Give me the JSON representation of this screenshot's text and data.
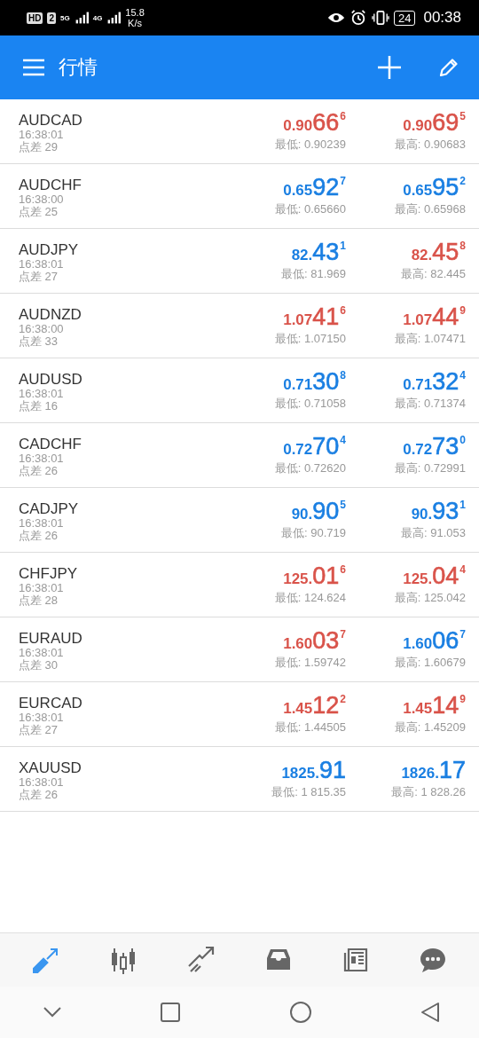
{
  "status_bar": {
    "hd": "HD",
    "sim": "2",
    "net1": "5G",
    "net2": "4G",
    "speed": "15.8",
    "speed_unit": "K/s",
    "battery": "24",
    "time": "00:38"
  },
  "header": {
    "title": "行情"
  },
  "quotes": [
    {
      "symbol": "AUDCAD",
      "time": "16:38:01",
      "spread": "点差 29",
      "bid": {
        "small": "0.90",
        "big": "66",
        "sup": "6",
        "color": "#d9534a"
      },
      "ask": {
        "small": "0.90",
        "big": "69",
        "sup": "5",
        "color": "#d9534a"
      },
      "low": "最低: 0.90239",
      "high": "最高: 0.90683"
    },
    {
      "symbol": "AUDCHF",
      "time": "16:38:00",
      "spread": "点差 25",
      "bid": {
        "small": "0.65",
        "big": "92",
        "sup": "7",
        "color": "#1a7fe2"
      },
      "ask": {
        "small": "0.65",
        "big": "95",
        "sup": "2",
        "color": "#1a7fe2"
      },
      "low": "最低: 0.65660",
      "high": "最高: 0.65968"
    },
    {
      "symbol": "AUDJPY",
      "time": "16:38:01",
      "spread": "点差 27",
      "bid": {
        "small": "82.",
        "big": "43",
        "sup": "1",
        "color": "#1a7fe2"
      },
      "ask": {
        "small": "82.",
        "big": "45",
        "sup": "8",
        "color": "#d9534a"
      },
      "low": "最低: 81.969",
      "high": "最高: 82.445"
    },
    {
      "symbol": "AUDNZD",
      "time": "16:38:00",
      "spread": "点差 33",
      "bid": {
        "small": "1.07",
        "big": "41",
        "sup": "6",
        "color": "#d9534a"
      },
      "ask": {
        "small": "1.07",
        "big": "44",
        "sup": "9",
        "color": "#d9534a"
      },
      "low": "最低: 1.07150",
      "high": "最高: 1.07471"
    },
    {
      "symbol": "AUDUSD",
      "time": "16:38:01",
      "spread": "点差 16",
      "bid": {
        "small": "0.71",
        "big": "30",
        "sup": "8",
        "color": "#1a7fe2"
      },
      "ask": {
        "small": "0.71",
        "big": "32",
        "sup": "4",
        "color": "#1a7fe2"
      },
      "low": "最低: 0.71058",
      "high": "最高: 0.71374"
    },
    {
      "symbol": "CADCHF",
      "time": "16:38:01",
      "spread": "点差 26",
      "bid": {
        "small": "0.72",
        "big": "70",
        "sup": "4",
        "color": "#1a7fe2"
      },
      "ask": {
        "small": "0.72",
        "big": "73",
        "sup": "0",
        "color": "#1a7fe2"
      },
      "low": "最低: 0.72620",
      "high": "最高: 0.72991"
    },
    {
      "symbol": "CADJPY",
      "time": "16:38:01",
      "spread": "点差 26",
      "bid": {
        "small": "90.",
        "big": "90",
        "sup": "5",
        "color": "#1a7fe2"
      },
      "ask": {
        "small": "90.",
        "big": "93",
        "sup": "1",
        "color": "#1a7fe2"
      },
      "low": "最低: 90.719",
      "high": "最高: 91.053"
    },
    {
      "symbol": "CHFJPY",
      "time": "16:38:01",
      "spread": "点差 28",
      "bid": {
        "small": "125.",
        "big": "01",
        "sup": "6",
        "color": "#d9534a"
      },
      "ask": {
        "small": "125.",
        "big": "04",
        "sup": "4",
        "color": "#d9534a"
      },
      "low": "最低: 124.624",
      "high": "最高: 125.042"
    },
    {
      "symbol": "EURAUD",
      "time": "16:38:01",
      "spread": "点差 30",
      "bid": {
        "small": "1.60",
        "big": "03",
        "sup": "7",
        "color": "#d9534a"
      },
      "ask": {
        "small": "1.60",
        "big": "06",
        "sup": "7",
        "color": "#1a7fe2"
      },
      "low": "最低: 1.59742",
      "high": "最高: 1.60679"
    },
    {
      "symbol": "EURCAD",
      "time": "16:38:01",
      "spread": "点差 27",
      "bid": {
        "small": "1.45",
        "big": "12",
        "sup": "2",
        "color": "#d9534a"
      },
      "ask": {
        "small": "1.45",
        "big": "14",
        "sup": "9",
        "color": "#d9534a"
      },
      "low": "最低: 1.44505",
      "high": "最高: 1.45209"
    },
    {
      "symbol": "XAUUSD",
      "time": "16:38:01",
      "spread": "点差 26",
      "bid": {
        "small": "1825.",
        "big": "91",
        "color": "#1a7fe2"
      },
      "ask": {
        "small": "1826.",
        "big": "17",
        "color": "#1a7fe2"
      },
      "low": "最低: 1 815.35",
      "high": "最高: 1 828.26"
    }
  ],
  "bottom_tabs": [
    {
      "kind": "quotes",
      "selected": true
    },
    {
      "kind": "chart",
      "selected": false
    },
    {
      "kind": "trade",
      "selected": false
    },
    {
      "kind": "history",
      "selected": false
    },
    {
      "kind": "news",
      "selected": false
    },
    {
      "kind": "chat",
      "selected": false
    }
  ]
}
